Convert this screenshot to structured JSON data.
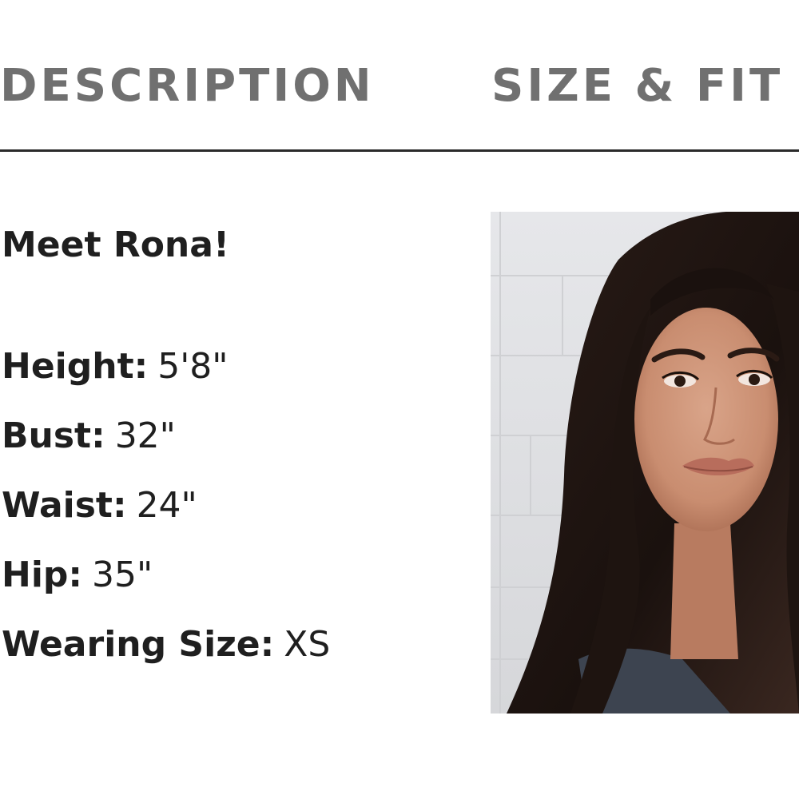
{
  "tabs": [
    {
      "label": "DESCRIPTION"
    },
    {
      "label": "SIZE & FIT"
    }
  ],
  "model": {
    "intro": "Meet Rona!",
    "measurements": [
      {
        "label": "Height:",
        "value": "5'8\""
      },
      {
        "label": "Bust:",
        "value": "32\""
      },
      {
        "label": "Waist:",
        "value": "24\""
      },
      {
        "label": "Hip:",
        "value": "35\""
      },
      {
        "label": "Wearing Size:",
        "value": "XS"
      }
    ]
  },
  "colors": {
    "tab_text": "#707070",
    "divider": "#2a2a2a",
    "body_text": "#1f1f1f"
  }
}
